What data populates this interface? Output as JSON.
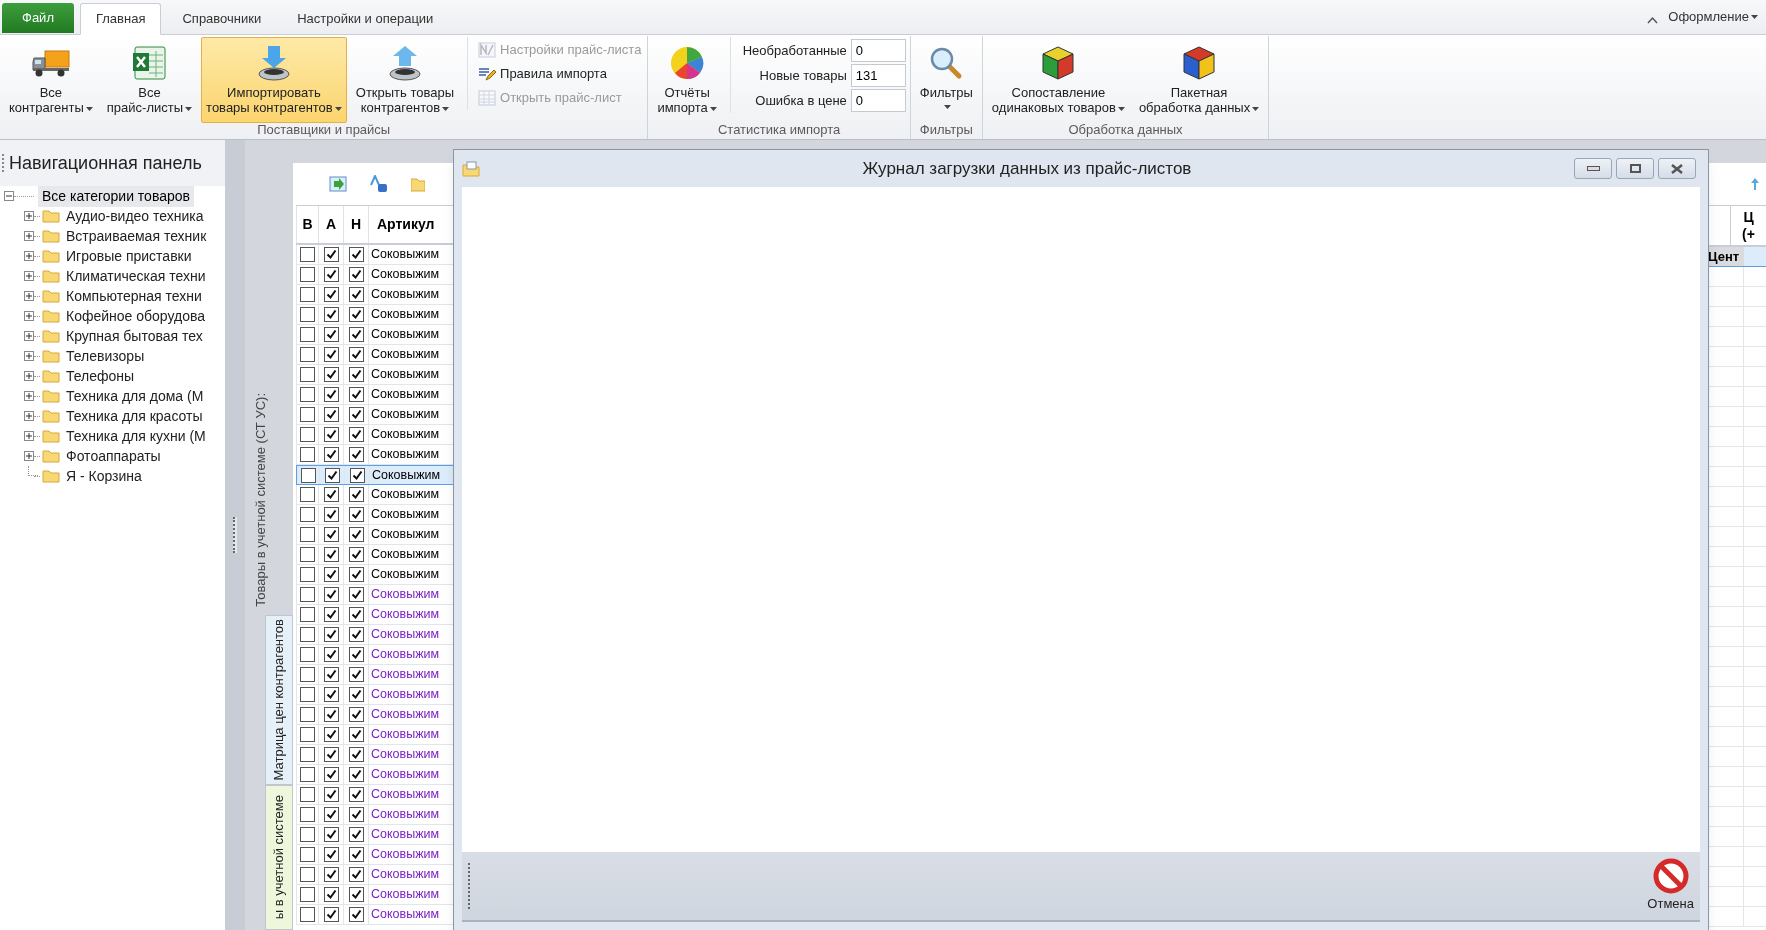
{
  "ribbon": {
    "tabs": [
      {
        "label": "Файл",
        "kind": "file",
        "selected": false
      },
      {
        "label": "Главная",
        "kind": "tab",
        "selected": true
      },
      {
        "label": "Справочники",
        "kind": "tab",
        "selected": false
      },
      {
        "label": "Настройки и операции",
        "kind": "tab",
        "selected": false
      }
    ],
    "style_menu": {
      "label": "Оформление",
      "dropdown": true
    },
    "groups": [
      {
        "label": "Поставщики и прайсы",
        "items": [
          {
            "kind": "large",
            "lines": [
              "Все",
              "контрагенты"
            ],
            "dropdown": true,
            "selected": false
          },
          {
            "kind": "large",
            "lines": [
              "Все",
              "прайс-листы"
            ],
            "dropdown": true,
            "selected": false
          },
          {
            "kind": "large",
            "lines": [
              "Импортировать",
              "товары контрагентов"
            ],
            "dropdown": true,
            "selected": true
          },
          {
            "kind": "large",
            "lines": [
              "Открыть товары",
              "контрагентов"
            ],
            "dropdown": true,
            "selected": false
          },
          {
            "kind": "small",
            "label": "Настройки прайс-листа",
            "disabled": true
          },
          {
            "kind": "small",
            "label": "Правила импорта",
            "disabled": false
          },
          {
            "kind": "small",
            "label": "Открыть прайс-лист",
            "disabled": true
          }
        ]
      },
      {
        "label": "Статистика импорта",
        "items": [
          {
            "kind": "large",
            "lines": [
              "Отчёты",
              "импорта"
            ],
            "dropdown": true,
            "selected": false
          },
          {
            "kind": "stat",
            "label": "Необработанные",
            "value": "0"
          },
          {
            "kind": "stat",
            "label": "Новые товары",
            "value": "131"
          },
          {
            "kind": "stat",
            "label": "Ошибка в цене",
            "value": "0"
          }
        ]
      },
      {
        "label": "Фильтры",
        "items": [
          {
            "kind": "large",
            "lines": [
              "Фильтры"
            ],
            "dropdown": true,
            "selected": false
          }
        ]
      },
      {
        "label": "Обработка данных",
        "items": [
          {
            "kind": "large",
            "lines": [
              "Сопоставление",
              "одинаковых товаров"
            ],
            "dropdown": true,
            "selected": false
          },
          {
            "kind": "large",
            "lines": [
              "Пакетная",
              "обработка данных"
            ],
            "dropdown": true,
            "selected": false
          }
        ]
      }
    ]
  },
  "nav": {
    "title": "Навигационная панель",
    "tree": [
      {
        "label": "Все категории товаров",
        "expanded": true,
        "selected": true,
        "children": [
          {
            "label": "Аудио-видео техника",
            "expandable": true
          },
          {
            "label": "Встраиваемая техник",
            "expandable": true
          },
          {
            "label": "Игровые приставки",
            "expandable": true
          },
          {
            "label": "Климатическая техни",
            "expandable": true
          },
          {
            "label": "Компьютерная техни",
            "expandable": true
          },
          {
            "label": "Кофейное оборудова",
            "expandable": true
          },
          {
            "label": "Крупная бытовая тех",
            "expandable": true
          },
          {
            "label": "Телевизоры",
            "expandable": true
          },
          {
            "label": "Телефоны",
            "expandable": true
          },
          {
            "label": "Техника для дома (М",
            "expandable": true
          },
          {
            "label": "Техника для красоты",
            "expandable": true
          },
          {
            "label": "Техника для кухни (М",
            "expandable": true
          },
          {
            "label": "Фотоаппараты",
            "expandable": true
          },
          {
            "label": "Я - Корзина",
            "expandable": false
          }
        ]
      }
    ]
  },
  "products": {
    "caption": "Товары в учетной системе (СТ УС):",
    "side_tabs": [
      {
        "label": "Матрица цен контрагентов",
        "selected": false
      },
      {
        "label": "ы в учетной системе",
        "selected": true
      }
    ],
    "grid": {
      "columns": [
        "В",
        "А",
        "Н",
        "Артикул"
      ],
      "rows": [
        {
          "b": false,
          "a": true,
          "n": true,
          "article": "Соковыжим",
          "color": "#000000",
          "selected": false
        },
        {
          "b": false,
          "a": true,
          "n": true,
          "article": "Соковыжим",
          "color": "#000000",
          "selected": false
        },
        {
          "b": false,
          "a": true,
          "n": true,
          "article": "Соковыжим",
          "color": "#000000",
          "selected": false
        },
        {
          "b": false,
          "a": true,
          "n": true,
          "article": "Соковыжим",
          "color": "#000000",
          "selected": false
        },
        {
          "b": false,
          "a": true,
          "n": true,
          "article": "Соковыжим",
          "color": "#000000",
          "selected": false
        },
        {
          "b": false,
          "a": true,
          "n": true,
          "article": "Соковыжим",
          "color": "#000000",
          "selected": false
        },
        {
          "b": false,
          "a": true,
          "n": true,
          "article": "Соковыжим",
          "color": "#000000",
          "selected": false
        },
        {
          "b": false,
          "a": true,
          "n": true,
          "article": "Соковыжим",
          "color": "#000000",
          "selected": false
        },
        {
          "b": false,
          "a": true,
          "n": true,
          "article": "Соковыжим",
          "color": "#000000",
          "selected": false
        },
        {
          "b": false,
          "a": true,
          "n": true,
          "article": "Соковыжим",
          "color": "#000000",
          "selected": false
        },
        {
          "b": false,
          "a": true,
          "n": true,
          "article": "Соковыжим",
          "color": "#000000",
          "selected": false
        },
        {
          "b": false,
          "a": true,
          "n": true,
          "article": "Соковыжим",
          "color": "#000000",
          "selected": true
        },
        {
          "b": false,
          "a": true,
          "n": true,
          "article": "Соковыжим",
          "color": "#000000",
          "selected": false
        },
        {
          "b": false,
          "a": true,
          "n": true,
          "article": "Соковыжим",
          "color": "#000000",
          "selected": false
        },
        {
          "b": false,
          "a": true,
          "n": true,
          "article": "Соковыжим",
          "color": "#000000",
          "selected": false
        },
        {
          "b": false,
          "a": true,
          "n": true,
          "article": "Соковыжим",
          "color": "#000000",
          "selected": false
        },
        {
          "b": false,
          "a": true,
          "n": true,
          "article": "Соковыжим",
          "color": "#000000",
          "selected": false
        },
        {
          "b": false,
          "a": true,
          "n": true,
          "article": "Соковыжим",
          "color": "#7b22c4",
          "selected": false
        },
        {
          "b": false,
          "a": true,
          "n": true,
          "article": "Соковыжим",
          "color": "#7b22c4",
          "selected": false
        },
        {
          "b": false,
          "a": true,
          "n": true,
          "article": "Соковыжим",
          "color": "#7b22c4",
          "selected": false
        },
        {
          "b": false,
          "a": true,
          "n": true,
          "article": "Соковыжим",
          "color": "#7b22c4",
          "selected": false
        },
        {
          "b": false,
          "a": true,
          "n": true,
          "article": "Соковыжим",
          "color": "#7b22c4",
          "selected": false
        },
        {
          "b": false,
          "a": true,
          "n": true,
          "article": "Соковыжим",
          "color": "#7b22c4",
          "selected": false
        },
        {
          "b": false,
          "a": true,
          "n": true,
          "article": "Соковыжим",
          "color": "#7b22c4",
          "selected": false
        },
        {
          "b": false,
          "a": true,
          "n": true,
          "article": "Соковыжим",
          "color": "#7b22c4",
          "selected": false
        },
        {
          "b": false,
          "a": true,
          "n": true,
          "article": "Соковыжим",
          "color": "#7b22c4",
          "selected": false
        },
        {
          "b": false,
          "a": true,
          "n": true,
          "article": "Соковыжим",
          "color": "#7b22c4",
          "selected": false
        },
        {
          "b": false,
          "a": true,
          "n": true,
          "article": "Соковыжим",
          "color": "#7b22c4",
          "selected": false
        },
        {
          "b": false,
          "a": true,
          "n": true,
          "article": "Соковыжим",
          "color": "#7b22c4",
          "selected": false
        },
        {
          "b": false,
          "a": true,
          "n": true,
          "article": "Соковыжим",
          "color": "#7b22c4",
          "selected": false
        },
        {
          "b": false,
          "a": true,
          "n": true,
          "article": "Соковыжим",
          "color": "#7b22c4",
          "selected": false
        },
        {
          "b": false,
          "a": true,
          "n": true,
          "article": "Соковыжим",
          "color": "#7b22c4",
          "selected": false
        },
        {
          "b": false,
          "a": true,
          "n": true,
          "article": "Соковыжим",
          "color": "#7b22c4",
          "selected": false
        },
        {
          "b": false,
          "a": true,
          "n": true,
          "article": "Соковыжим",
          "color": "#7b22c4",
          "selected": false
        }
      ]
    },
    "right_grid": {
      "header_lines": [
        "Ц",
        "(+"
      ],
      "subheader": "Цент"
    }
  },
  "dialog": {
    "title": "Журнал загрузки данных из прайс-листов",
    "cancel": "Отмена"
  }
}
